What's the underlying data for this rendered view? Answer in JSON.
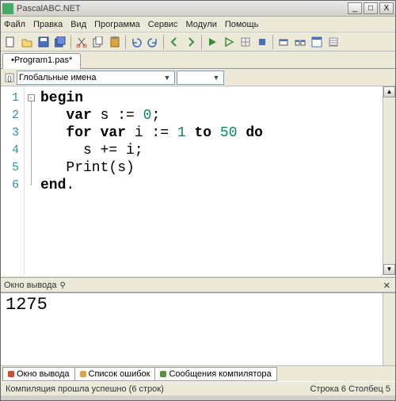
{
  "window": {
    "title": "PascalABC.NET"
  },
  "menu": {
    "file": "Файл",
    "edit": "Правка",
    "view": "Вид",
    "program": "Программа",
    "service": "Сервис",
    "modules": "Модули",
    "help": "Помощь"
  },
  "tabs": {
    "file": "•Program1.pas*"
  },
  "combo": {
    "label": "Глобальные имена"
  },
  "code": {
    "l1": "begin",
    "l2a": "   ",
    "l2b": "var",
    "l2c": " s := ",
    "l2d": "0",
    "l2e": ";",
    "l3a": "   ",
    "l3b": "for",
    "l3c": " ",
    "l3d": "var",
    "l3e": " i := ",
    "l3f": "1",
    "l3g": " ",
    "l3h": "to",
    "l3i": " ",
    "l3j": "50",
    "l3k": " ",
    "l3l": "do",
    "l4": "     s += i;",
    "l5": "   Print(s)",
    "l6": "end"
  },
  "lines": {
    "n1": "1",
    "n2": "2",
    "n3": "3",
    "n4": "4",
    "n5": "5",
    "n6": "6"
  },
  "fold": {
    "sym": "⊟",
    "end": "."
  },
  "output_panel": {
    "title": "Окно вывода",
    "value": "1275"
  },
  "bottom_tabs": {
    "output": "Окно вывода",
    "errors": "Список ошибок",
    "compiler": "Сообщения компилятора"
  },
  "status": {
    "left": "Компиляция прошла успешно (6 строк)",
    "right": "Строка  6  Столбец  5"
  },
  "colors": {
    "out": "#c94f2e",
    "err": "#d9a441",
    "comp": "#5a8f3e"
  }
}
